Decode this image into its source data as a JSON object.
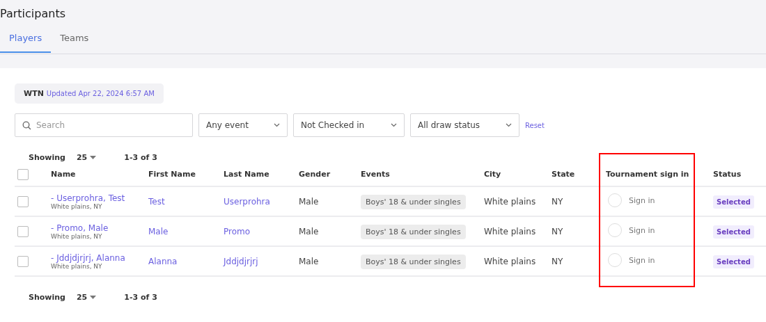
{
  "title": "Participants",
  "tabs": [
    {
      "label": "Players",
      "selected": true
    },
    {
      "label": "Teams",
      "selected": false
    }
  ],
  "wtn": {
    "label": "WTN",
    "updated": "Updated Apr 22, 2024 6:57 AM"
  },
  "search": {
    "placeholder": "Search"
  },
  "filters": [
    "Any event",
    "Not Checked in",
    "All draw status"
  ],
  "reset": "Reset",
  "pager_top": {
    "label": "Showing",
    "size": "25",
    "range": "1-3 of 3"
  },
  "table": {
    "all_checked": false,
    "columns": [
      {
        "label": "Name",
        "highlighted": false
      },
      {
        "label": "First Name",
        "highlighted": false
      },
      {
        "label": "Last Name",
        "highlighted": false
      },
      {
        "label": "Gender",
        "highlighted": false
      },
      {
        "label": "Events",
        "highlighted": false
      },
      {
        "label": "City",
        "highlighted": false
      },
      {
        "label": "State",
        "highlighted": false
      },
      {
        "label": "Tournament sign in",
        "highlighted": true
      },
      {
        "label": "Status",
        "highlighted": false
      }
    ],
    "rows": [
      {
        "checked": false,
        "marker": "-",
        "name": "Userprohra, Test",
        "location": "White plains, NY",
        "first": "Test",
        "last": "Userprohra",
        "gender": "Male",
        "event": "Boys' 18 & under singles",
        "city": "White plains",
        "state": "NY",
        "signed_in": false,
        "sign_in": "Sign in",
        "status": "Selected"
      },
      {
        "checked": false,
        "marker": "-",
        "name": "Promo, Male",
        "location": "White plains, NY",
        "first": "Male",
        "last": "Promo",
        "gender": "Male",
        "event": "Boys' 18 & under singles",
        "city": "White plains",
        "state": "NY",
        "signed_in": false,
        "sign_in": "Sign in",
        "status": "Selected"
      },
      {
        "checked": false,
        "marker": "-",
        "name": "Jddjdjrjrj, Alanna",
        "location": "White plains, NY",
        "first": "Alanna",
        "last": "Jddjdjrjrj",
        "gender": "Male",
        "event": "Boys' 18 & under singles",
        "city": "White plains",
        "state": "NY",
        "signed_in": false,
        "sign_in": "Sign in",
        "status": "Selected"
      }
    ]
  },
  "pager_bottom": {
    "label": "Showing",
    "size": "25",
    "range": "1-3 of 3"
  }
}
